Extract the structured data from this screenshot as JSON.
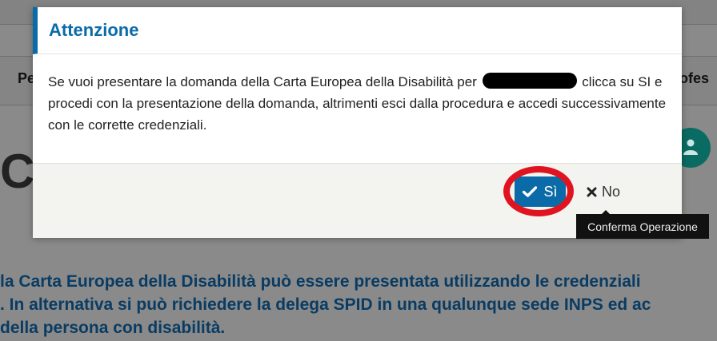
{
  "background": {
    "nav_left": "Pe",
    "nav_right": "rofes",
    "heading": "Ca",
    "paragraph_lines": [
      "la Carta Europea della Disabilità può essere presentata utilizzando le credenziali",
      ". In alternativa si può richiedere la delega SPID in una qualunque sede INPS ed ac",
      "della persona con disabilità."
    ]
  },
  "modal": {
    "title": "Attenzione",
    "message_before": "Se vuoi presentare la domanda della Carta Europea della Disabilità per",
    "message_after": "clicca su SI e procedi con la presentazione della domanda, altrimenti esci dalla procedura e accedi successivamente con le corrette credenziali.",
    "buttons": {
      "yes_label": "Sì",
      "no_label": "No"
    },
    "tooltip": "Conferma Operazione"
  },
  "colors": {
    "accent": "#0a6ba8",
    "highlight_circle": "#e01420"
  },
  "icons": {
    "yes": "check-icon",
    "no": "x-icon",
    "avatar": "user-icon"
  }
}
